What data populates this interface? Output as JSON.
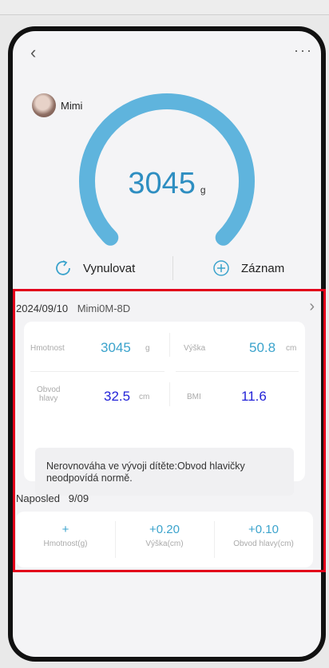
{
  "nav": {
    "back_icon": "‹",
    "more_icon": "···"
  },
  "user": {
    "name": "Mimi"
  },
  "gauge": {
    "value": "3045",
    "unit": "g",
    "fill_fraction": 0.75,
    "color": "#5fb4dd"
  },
  "actions": {
    "reset_label": "Vynulovat",
    "record_label": "Záznam"
  },
  "record": {
    "date": "2024/09/10",
    "age_tag": "Mimi0M-8D",
    "weight": {
      "label": "Hmotnost",
      "value": "3045",
      "unit": "g"
    },
    "height": {
      "label": "Výška",
      "value": "50.8",
      "unit": "cm"
    },
    "head": {
      "label_line1": "Obvod",
      "label_line2": "hlavy",
      "value": "32.5",
      "unit": "cm"
    },
    "bmi": {
      "label": "BMI",
      "value": "11.6"
    },
    "warning": "Nerovnováha ve vývoji dítěte:Obvod hlavičky neodpovídá normě."
  },
  "last": {
    "title": "Naposled",
    "date": "9/09",
    "changes": [
      {
        "value": "+",
        "label": "Hmotnost(g)"
      },
      {
        "value": "+0.20",
        "label": "Výška(cm)"
      },
      {
        "value": "+0.10",
        "label": "Obvod hlavy(cm)"
      }
    ]
  },
  "colors": {
    "accent": "#3ba3cc",
    "highlight_blue": "#2323d8",
    "annotation_red": "#e2001a"
  }
}
